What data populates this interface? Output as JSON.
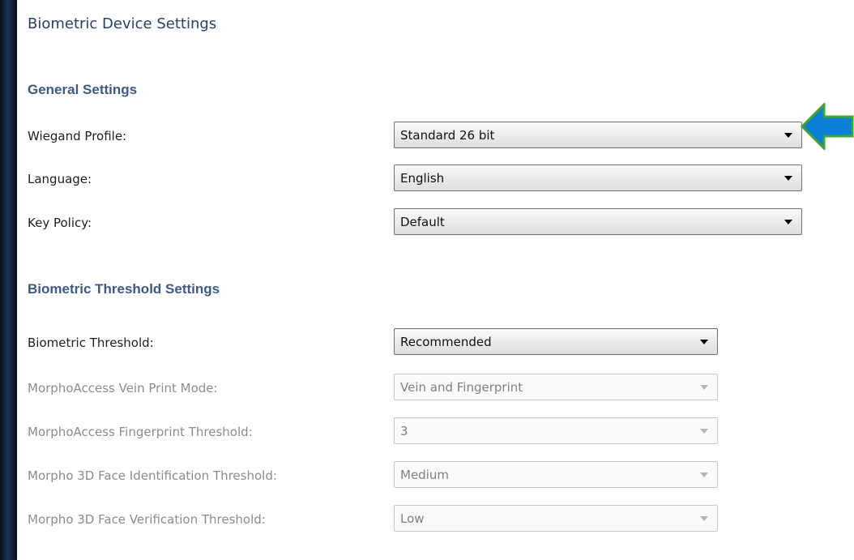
{
  "page": {
    "title": "Biometric Device Settings"
  },
  "general": {
    "heading": "General Settings",
    "wiegand": {
      "label": "Wiegand Profile:",
      "value": "Standard 26 bit"
    },
    "language": {
      "label": "Language:",
      "value": "English"
    },
    "key_policy": {
      "label": "Key Policy:",
      "value": "Default"
    }
  },
  "biometric": {
    "heading": "Biometric Threshold Settings",
    "threshold": {
      "label": "Biometric Threshold:",
      "value": "Recommended"
    },
    "vein_mode": {
      "label": "MorphoAccess Vein Print Mode:",
      "value": "Vein and Fingerprint",
      "enabled": false
    },
    "fingerprint_threshold": {
      "label": "MorphoAccess Fingerprint Threshold:",
      "value": "3",
      "enabled": false
    },
    "face_identification": {
      "label": "Morpho 3D Face Identification Threshold:",
      "value": "Medium",
      "enabled": false
    },
    "face_verification": {
      "label": "Morpho 3D Face Verification Threshold:",
      "value": "Low",
      "enabled": false
    }
  },
  "callout": {
    "icon": "arrow-left-icon",
    "fill_color": "#0a7fd8",
    "stroke_color": "#3fa535"
  },
  "colors": {
    "heading": "#23416f",
    "section_heading": "#3a5b87",
    "disabled_text": "#8c8c8c"
  }
}
